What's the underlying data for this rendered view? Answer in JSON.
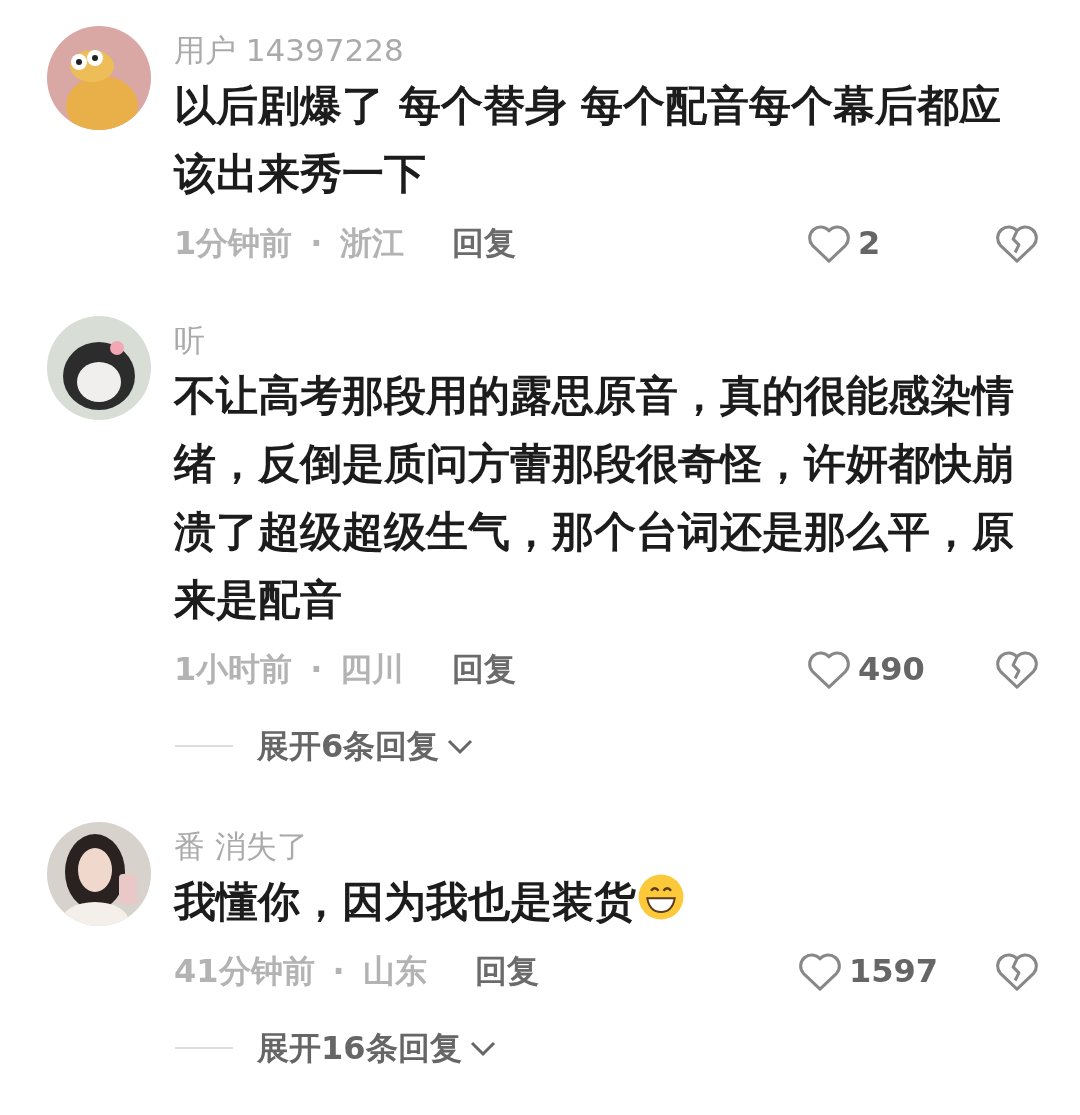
{
  "comments": [
    {
      "username": "用户 14397228",
      "text": "以后剧爆了 每个替身 每个配音每个幕后都应该出来秀一下",
      "emoji": false,
      "time": "1分钟前",
      "separator": "·",
      "location": "浙江",
      "reply": "回复",
      "likes": "2"
    },
    {
      "username": "听",
      "text": "不让高考那段用的露思原音，真的很能感染情绪，反倒是质问方蕾那段很奇怪，许妍都快崩溃了超级超级生气，那个台词还是那么平，原来是配音",
      "emoji": false,
      "time": "1小时前",
      "separator": "·",
      "location": "四川",
      "reply": "回复",
      "likes": "490",
      "expand": "展开6条回复"
    },
    {
      "username": "番 消失了",
      "text": "我懂你，因为我也是装货",
      "emoji": true,
      "time": "41分钟前",
      "separator": "·",
      "location": "山东",
      "reply": "回复",
      "likes": "1597",
      "expand": "展开16条回复"
    }
  ]
}
